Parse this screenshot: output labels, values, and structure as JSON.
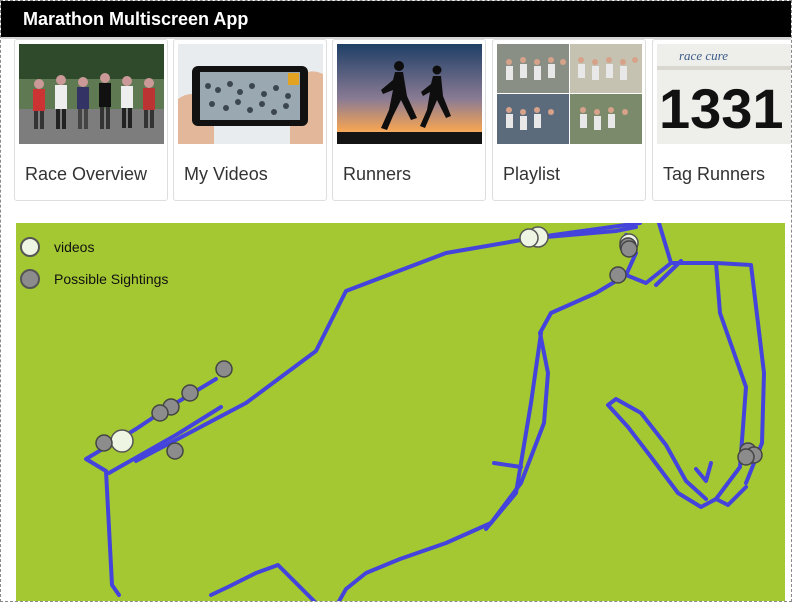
{
  "app": {
    "title": "Marathon Multiscreen App"
  },
  "tiles": [
    {
      "id": "race-overview",
      "label": "Race Overview"
    },
    {
      "id": "my-videos",
      "label": "My Videos"
    },
    {
      "id": "runners",
      "label": "Runners"
    },
    {
      "id": "playlist",
      "label": "Playlist"
    },
    {
      "id": "tag-runners",
      "label": "Tag Runners"
    }
  ],
  "bib_number": "1331",
  "bib_text": "race cure",
  "map": {
    "background_color": "#a4c832",
    "route_color": "#4444dd",
    "legend": [
      {
        "label": "videos",
        "color": "#eef5e2"
      },
      {
        "label": "Possible Sightings",
        "color": "#8c8c8c"
      }
    ]
  }
}
